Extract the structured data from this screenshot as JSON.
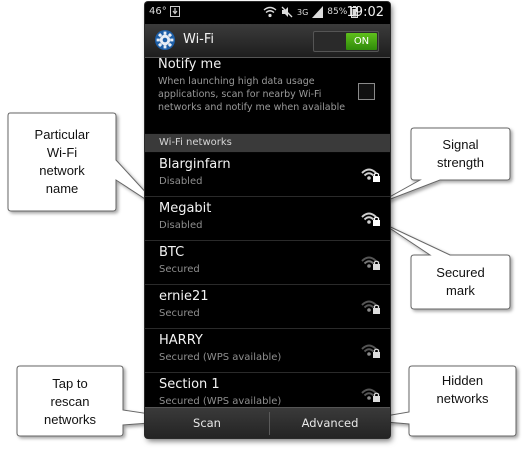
{
  "status_bar": {
    "temperature": "46°",
    "network_type": "3G",
    "battery_percent": "85%",
    "time": "19:02"
  },
  "title_bar": {
    "title": "Wi-Fi",
    "toggle_label": "ON"
  },
  "notify": {
    "title": "Notify me",
    "description": "When launching high data usage applications, scan for nearby Wi-Fi networks and notify me when available"
  },
  "section_header": "Wi-Fi networks",
  "networks": [
    {
      "name": "Blarginfarn",
      "status": "Disabled"
    },
    {
      "name": "Megabit",
      "status": "Disabled"
    },
    {
      "name": "BTC",
      "status": "Secured"
    },
    {
      "name": "ernie21",
      "status": "Secured"
    },
    {
      "name": "HARRY",
      "status": "Secured (WPS available)"
    },
    {
      "name": "Section 1",
      "status": "Secured (WPS available)"
    }
  ],
  "bottom_bar": {
    "scan_label": "Scan",
    "advanced_label": "Advanced"
  },
  "callouts": {
    "network_name": [
      "Particular",
      "Wi-Fi",
      "network",
      "name"
    ],
    "signal": [
      "Signal",
      "strength"
    ],
    "secured": [
      "Secured",
      "mark"
    ],
    "rescan": [
      "Tap to",
      "rescan",
      "networks"
    ],
    "hidden": [
      "Hidden",
      "networks"
    ]
  },
  "colors": {
    "toggle_on": "#3fa012",
    "background": "#000000",
    "section_header": "#3a3a3a"
  }
}
